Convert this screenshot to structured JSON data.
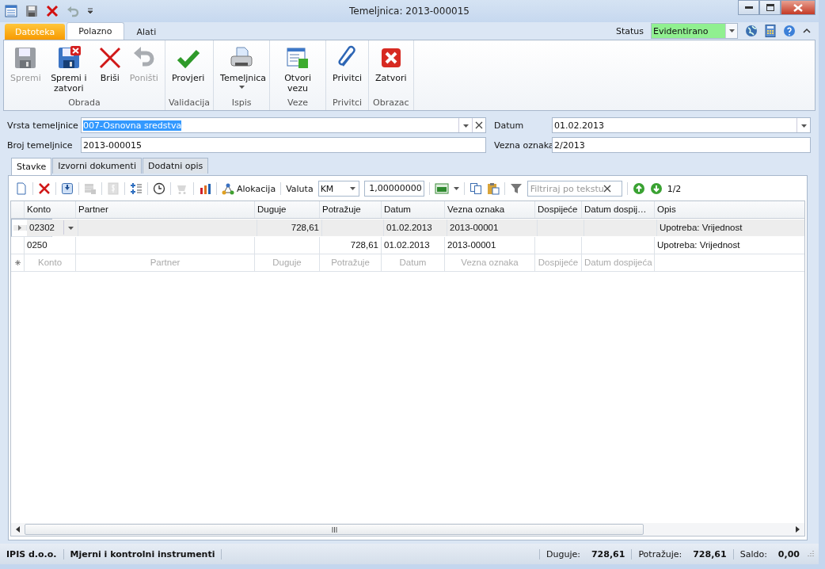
{
  "window": {
    "title": "Temeljnica: 2013-000015"
  },
  "ribbon_tabs": [
    {
      "label": "Datoteka",
      "kind": "file",
      "selected": false
    },
    {
      "label": "Polazno",
      "kind": "tab",
      "selected": true
    },
    {
      "label": "Alati",
      "kind": "tab",
      "selected": false
    }
  ],
  "status": {
    "label": "Status",
    "value": "Evidentirano"
  },
  "ribbon_groups": [
    {
      "label": "Obrada",
      "buttons": [
        {
          "label": "Spremi",
          "disabled": true,
          "dropdown": false
        },
        {
          "label": "Spremi i zatvori",
          "disabled": false,
          "dropdown": false
        },
        {
          "label": "Briši",
          "disabled": false,
          "dropdown": false
        },
        {
          "label": "Poništi",
          "disabled": true,
          "dropdown": false
        }
      ]
    },
    {
      "label": "Validacija",
      "buttons": [
        {
          "label": "Provjeri",
          "disabled": false,
          "dropdown": false
        }
      ]
    },
    {
      "label": "Ispis",
      "buttons": [
        {
          "label": "Temeljnica",
          "disabled": false,
          "dropdown": true
        }
      ]
    },
    {
      "label": "Veze",
      "buttons": [
        {
          "label": "Otvori vezu",
          "disabled": false,
          "dropdown": false
        }
      ]
    },
    {
      "label": "Privitci",
      "buttons": [
        {
          "label": "Privitci",
          "disabled": false,
          "dropdown": false
        }
      ]
    },
    {
      "label": "Obrazac",
      "buttons": [
        {
          "label": "Zatvori",
          "disabled": false,
          "dropdown": false
        }
      ]
    }
  ],
  "form": {
    "left": [
      {
        "label": "Vrsta temeljnice",
        "value": "007-Osnovna sredstva",
        "kind": "combo",
        "highlighted": true
      },
      {
        "label": "Broj temeljnice",
        "value": "2013-000015",
        "kind": "text",
        "highlighted": false
      }
    ],
    "right": [
      {
        "label": "Datum",
        "value": "01.02.2013",
        "kind": "date",
        "highlighted": false
      },
      {
        "label": "Vezna oznaka",
        "value": "2/2013",
        "kind": "text",
        "highlighted": false
      }
    ]
  },
  "doc_tabs": [
    {
      "label": "Stavke",
      "selected": true
    },
    {
      "label": "Izvorni dokumenti",
      "selected": false
    },
    {
      "label": "Dodatni opis",
      "selected": false
    }
  ],
  "toolbar": {
    "buttons": [
      {
        "disabled": false
      },
      {
        "disabled": false
      },
      {
        "disabled": false
      },
      {
        "disabled": true
      },
      {
        "disabled": true
      },
      {
        "disabled": false
      },
      {
        "disabled": false
      },
      {
        "disabled": true
      },
      {
        "disabled": false
      }
    ],
    "allocation": "Alokacija",
    "currency_label": "Valuta",
    "currency": "KM",
    "rate": "1,00000000",
    "filter_placeholder": "Filtriraj po tekstu",
    "page": "1/2"
  },
  "table": {
    "columns": [
      "Konto",
      "Partner",
      "Duguje",
      "Potražuje",
      "Datum",
      "Vezna oznaka",
      "Dospijeće",
      "Datum dospij…",
      "Opis"
    ],
    "rows": [
      {
        "selected": true,
        "cells": [
          "02302",
          "",
          "728,61",
          "",
          "01.02.2013",
          "2013-00001",
          "",
          "",
          "Upotreba: Vrijednost"
        ]
      },
      {
        "selected": false,
        "cells": [
          "0250",
          "",
          "",
          "728,61",
          "01.02.2013",
          "2013-00001",
          "",
          "",
          "Upotreba: Vrijednost"
        ]
      }
    ],
    "new_row": [
      "Konto",
      "Partner",
      "Duguje",
      "Potražuje",
      "Datum",
      "Vezna oznaka",
      "Dospijeće",
      "Datum dospijeća"
    ]
  },
  "status_bar": {
    "company": "IPIS d.o.o.",
    "description": "Mjerni i kontrolni instrumenti",
    "totals": [
      {
        "label": "Duguje:",
        "value": "728,61"
      },
      {
        "label": "Potražuje:",
        "value": "728,61"
      },
      {
        "label": "Saldo:",
        "value": "0,00"
      }
    ]
  }
}
